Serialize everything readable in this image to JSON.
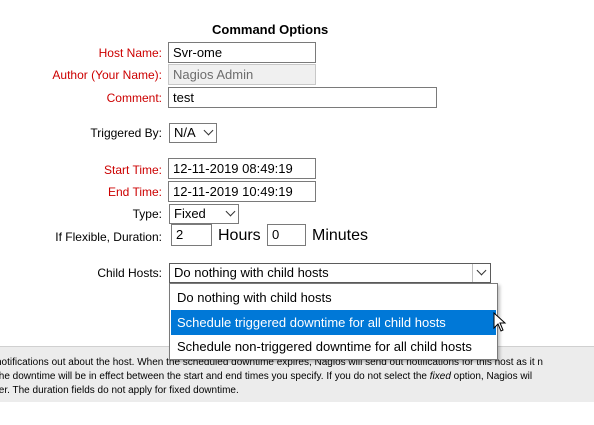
{
  "form": {
    "title": "Command Options",
    "host_name": {
      "label": "Host Name:",
      "value": "Svr-ome"
    },
    "author": {
      "label": "Author (Your Name):",
      "value": "Nagios Admin"
    },
    "comment": {
      "label": "Comment:",
      "value": "test"
    },
    "triggered_by": {
      "label": "Triggered By:",
      "value": "N/A"
    },
    "start_time": {
      "label": "Start Time:",
      "value": "12-11-2019 08:49:19"
    },
    "end_time": {
      "label": "End Time:",
      "value": "12-11-2019 10:49:19"
    },
    "type": {
      "label": "Type:",
      "value": "Fixed"
    },
    "duration": {
      "label": "If Flexible, Duration:",
      "hours_value": "2",
      "hours_label": "Hours",
      "minutes_value": "0",
      "minutes_label": "Minutes"
    },
    "child_hosts": {
      "label": "Child Hosts:",
      "selected": "Do nothing with child hosts",
      "options": [
        "Do nothing with child hosts",
        "Schedule triggered downtime for all child hosts",
        "Schedule non-triggered downtime for all child hosts"
      ],
      "highlighted_index": 1
    }
  },
  "description": {
    "line1": "notifications out about the host. When the scheduled downtime expires, Nagios will send out notifications for this host as it n",
    "line2a": "the downtime will be in effect between the start and end times you specify. If you do not select the ",
    "line2_em": "fixed",
    "line2b": " option, Nagios wil",
    "line3": "ter. The duration fields do not apply for fixed downtime."
  },
  "colors": {
    "required_label": "#cc0000",
    "highlight": "#0078d7"
  }
}
